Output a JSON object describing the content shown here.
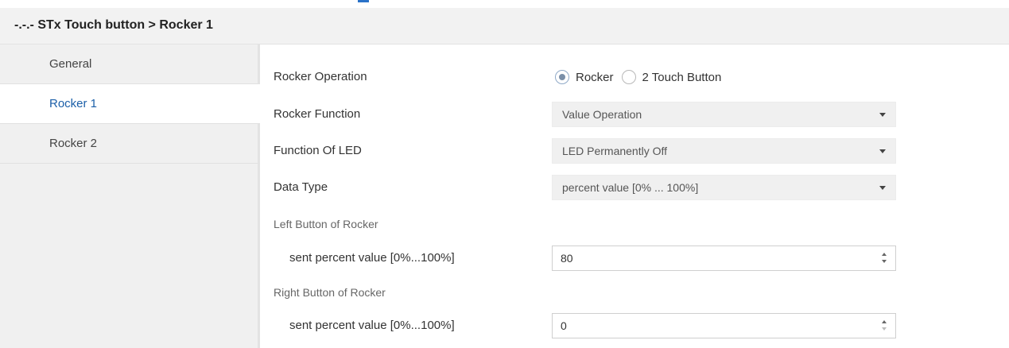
{
  "window": {
    "title": "-.-.- STx Touch button > Rocker 1"
  },
  "sidebar": {
    "items": [
      {
        "label": "General",
        "active": false
      },
      {
        "label": "Rocker 1",
        "active": true
      },
      {
        "label": "Rocker 2",
        "active": false
      }
    ]
  },
  "form": {
    "rocker_operation": {
      "label": "Rocker Operation",
      "options": [
        {
          "label": "Rocker",
          "checked": true
        },
        {
          "label": "2 Touch Button",
          "checked": false
        }
      ]
    },
    "rocker_function": {
      "label": "Rocker Function",
      "value": "Value Operation"
    },
    "function_of_led": {
      "label": "Function Of LED",
      "value": "LED Permanently Off"
    },
    "data_type": {
      "label": "Data Type",
      "value": "percent value [0% ... 100%]"
    },
    "left_button": {
      "section_label": "Left Button of Rocker",
      "field_label": "sent percent value [0%...100%]",
      "value": "80"
    },
    "right_button": {
      "section_label": "Right Button of Rocker",
      "field_label": "sent percent value [0%...100%]",
      "value": "0"
    }
  },
  "colors": {
    "active_nav_text": "#1b5fa8",
    "sidebar_bg": "#f0f0f0",
    "titlebar_bg": "#f2f2f2"
  }
}
